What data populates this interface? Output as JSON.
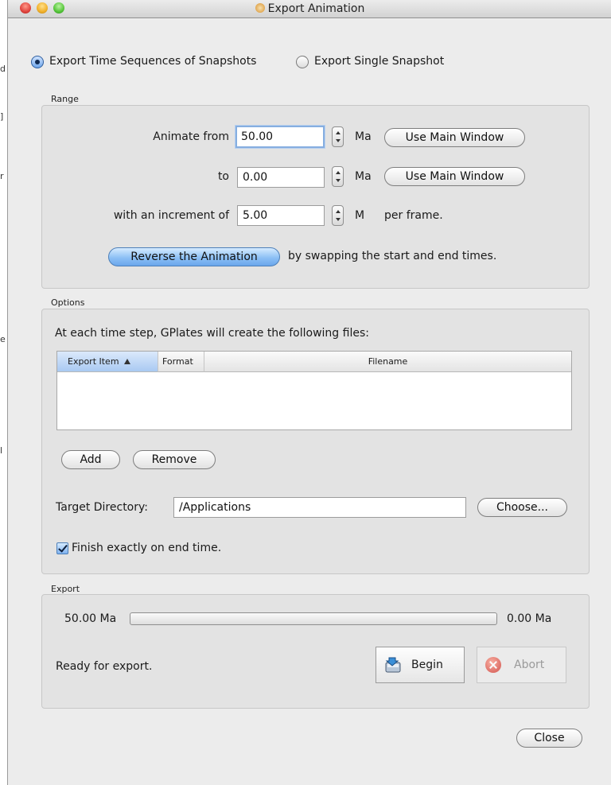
{
  "window": {
    "title": "Export Animation"
  },
  "mode": {
    "options": [
      {
        "label": "Export Time Sequences of Snapshots",
        "selected": true
      },
      {
        "label": "Export Single Snapshot",
        "selected": false
      }
    ]
  },
  "range": {
    "section_label": "Range",
    "from": {
      "label": "Animate from",
      "value": "50.00",
      "unit": "Ma",
      "button": "Use Main Window"
    },
    "to": {
      "label": "to",
      "value": "0.00",
      "unit": "Ma",
      "button": "Use Main Window"
    },
    "increment": {
      "label": "with an increment of",
      "value": "5.00",
      "unit": "M",
      "suffix": "per frame."
    },
    "reverse": {
      "button": "Reverse the Animation",
      "description": "by swapping the start and end times."
    }
  },
  "options": {
    "section_label": "Options",
    "intro": "At each time step, GPlates will create the following files:",
    "table": {
      "columns": [
        "Export Item",
        "Format",
        "Filename"
      ],
      "sorted_column": "Export Item",
      "rows": []
    },
    "add_button": "Add",
    "remove_button": "Remove",
    "target_directory": {
      "label": "Target Directory:",
      "value": "/Applications",
      "button": "Choose..."
    },
    "finish_exactly": {
      "label": "Finish exactly on end time.",
      "checked": true
    }
  },
  "export": {
    "section_label": "Export",
    "start_label": "50.00 Ma",
    "end_label": "0.00 Ma",
    "progress": 0,
    "status": "Ready for export.",
    "begin_button": "Begin",
    "abort_button": "Abort"
  },
  "footer": {
    "close_button": "Close"
  }
}
